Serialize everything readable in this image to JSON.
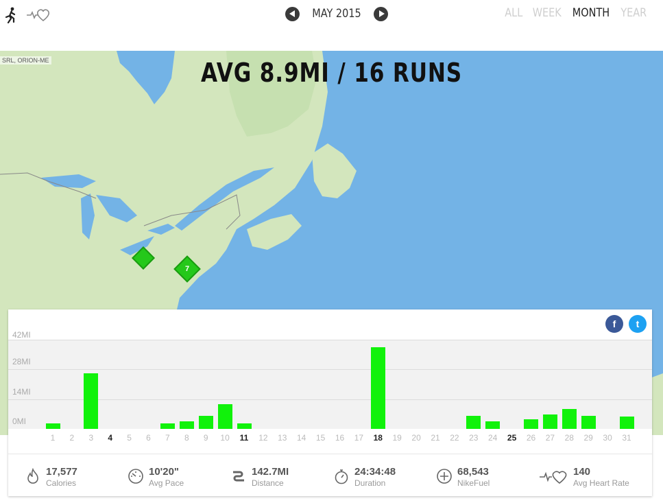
{
  "header": {
    "month_label": "MAY 2015",
    "range_tabs": [
      "ALL",
      "WEEK",
      "MONTH",
      "YEAR"
    ],
    "active_tab": "MONTH"
  },
  "map": {
    "attribution": "SRL, ORION-ME",
    "headline": "AVG 8.9MI / 16 RUNS",
    "markers": [
      {
        "label": ""
      },
      {
        "label": "7"
      }
    ],
    "colors": {
      "water": "#73b3e6",
      "land": "#cfe4b8",
      "marker": "#25c81a"
    }
  },
  "share": {
    "facebook": "f",
    "twitter": "t"
  },
  "chart_data": {
    "type": "bar",
    "ylabel_ticks": [
      "42MI",
      "28MI",
      "14MI",
      "0MI"
    ],
    "ylim": [
      0,
      42
    ],
    "categories": [
      "1",
      "2",
      "3",
      "4",
      "5",
      "6",
      "7",
      "8",
      "9",
      "10",
      "11",
      "12",
      "13",
      "14",
      "15",
      "16",
      "17",
      "18",
      "19",
      "20",
      "21",
      "22",
      "23",
      "24",
      "25",
      "26",
      "27",
      "28",
      "29",
      "30",
      "31"
    ],
    "bold_categories": [
      "4",
      "11",
      "18",
      "25"
    ],
    "values": [
      2.7,
      0,
      26.2,
      0,
      0,
      0,
      2.7,
      3.7,
      6.1,
      11.6,
      2.7,
      0,
      0,
      0,
      0,
      0,
      0,
      38.5,
      0,
      0,
      0,
      0,
      6.1,
      3.7,
      0,
      4.6,
      6.7,
      9.5,
      6.1,
      0,
      5.8
    ],
    "bar_color": "#11f20b"
  },
  "stats": [
    {
      "icon": "flame-icon",
      "value": "17,577",
      "label": "Calories"
    },
    {
      "icon": "gauge-icon",
      "value": "10'20\"",
      "label": "Avg Pace"
    },
    {
      "icon": "route-icon",
      "value": "142.7MI",
      "label": "Distance"
    },
    {
      "icon": "stopwatch-icon",
      "value": "24:34:48",
      "label": "Duration"
    },
    {
      "icon": "nikefuel-icon",
      "value": "68,543",
      "label": "NikeFuel"
    },
    {
      "icon": "heart-rate-icon",
      "value": "140",
      "label": "Avg Heart Rate"
    }
  ]
}
